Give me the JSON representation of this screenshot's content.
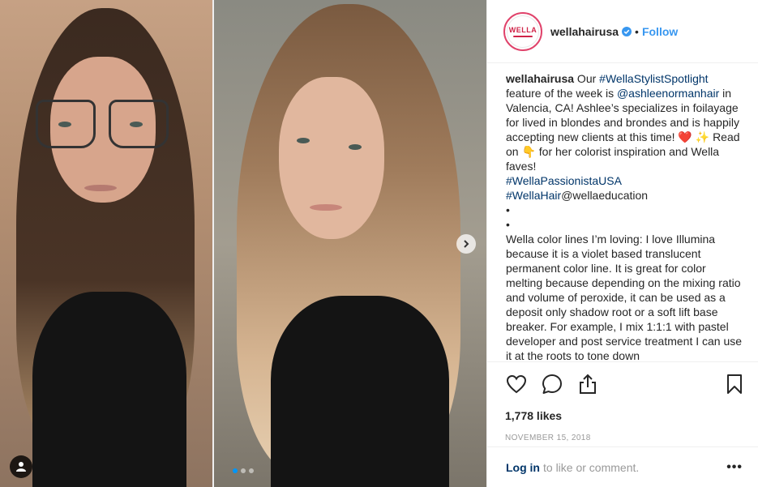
{
  "post": {
    "username": "wellahairusa",
    "separator": "•",
    "follow_label": "Follow",
    "avatar_text": "WELLA",
    "caption": {
      "username": "wellahairusa",
      "text_1": " Our ",
      "hashtag_1": "#WellaStylistSpotlight",
      "text_2": " feature of the week is ",
      "mention_1": "@ashleenormanhair",
      "text_3": " in Valencia, CA! Ashlee’s specializes in foilayage for lived in blondes and brondes and is happily accepting new clients at this time! ❤️ ✨ Read on 👇 for her colorist inspiration and Wella faves!\n",
      "hashtag_2": "#WellaPassionistaUSA",
      "newline": "\n",
      "hashtag_3": "#WellaHair",
      "text_4": "@wellaeducation\n•\n•\nWella color lines I’m loving: I love Illumina because it is a violet based translucent permanent color line. It is great for color melting because depending on the mixing ratio and volume of peroxide, it can be used as a deposit only shadow root or a soft lift base breaker. For example, I mix 1:1:1 with pastel developer and post service treatment I can use it at the roots to tone down"
    },
    "likes": "1,778 likes",
    "date": "NOVEMBER 15, 2018",
    "login_link": "Log in",
    "login_rest": "to like or comment.",
    "more": "•••"
  },
  "icons": {
    "like": "heart-icon",
    "comment": "comment-icon",
    "share": "share-icon",
    "save": "bookmark-icon",
    "verified": "verified-badge-icon",
    "next": "chevron-right-icon",
    "tag": "user-tag-icon"
  },
  "colors": {
    "link_blue": "#3897f0",
    "dark_link": "#003569",
    "brand_red": "#d02348"
  },
  "carousel": {
    "slides": 3,
    "active": 0
  }
}
